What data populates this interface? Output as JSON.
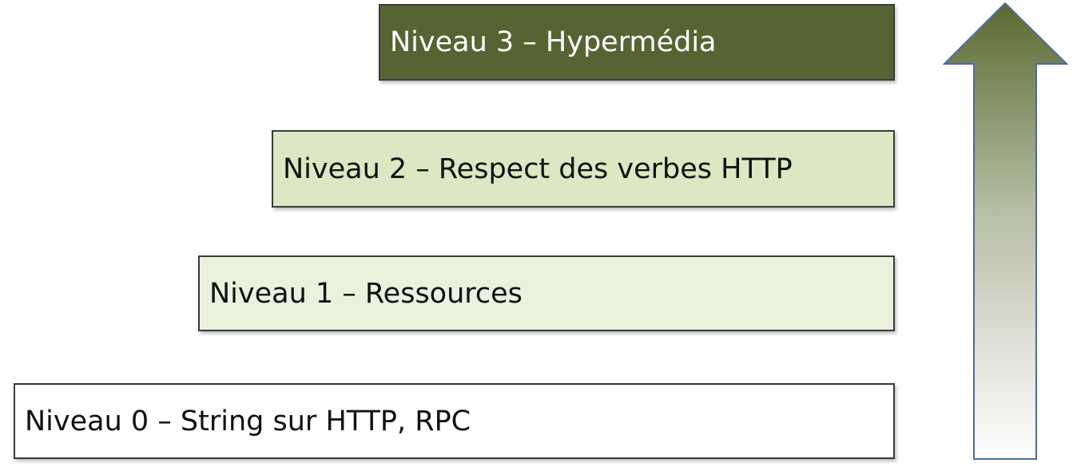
{
  "levels": [
    {
      "label": "Niveau 0 – String sur HTTP, RPC",
      "fill": "#ffffff"
    },
    {
      "label": "Niveau 1 – Ressources",
      "fill": "#eaf1dc"
    },
    {
      "label": "Niveau 2 – Respect des verbes HTTP",
      "fill": "#dce7c3"
    },
    {
      "label": "Niveau 3 – Hypermédia",
      "fill": "#566433"
    }
  ],
  "arrow": {
    "color_top": "#5a6a30",
    "color_bottom": "#ffffff",
    "outline": "#4a6aa8"
  }
}
